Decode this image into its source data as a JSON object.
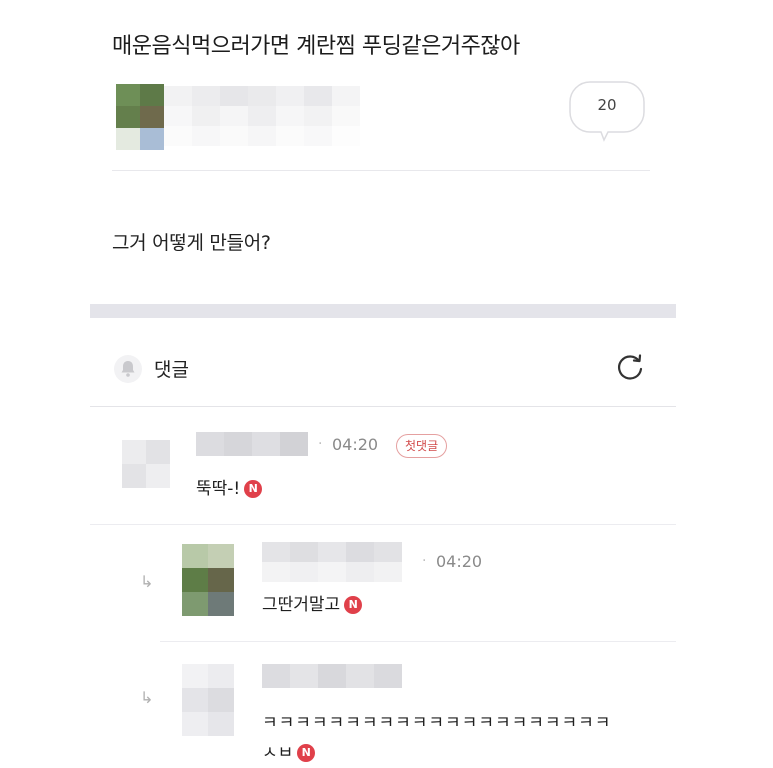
{
  "post": {
    "title": "매운음식먹으러가면 계란찜 푸딩같은거주잖아",
    "comment_count": "20",
    "body": "그거 어떻게 만들어?"
  },
  "comments_section": {
    "label": "댓글",
    "icons": {
      "bell": "bell-icon",
      "refresh": "refresh-icon"
    }
  },
  "comments": [
    {
      "time": "04:20",
      "badge": "첫댓글",
      "text": "뚝딱-!",
      "new_badge": "N"
    },
    {
      "time": "04:20",
      "text": "그딴거말고",
      "new_badge": "N",
      "is_reply": true
    },
    {
      "text_line1": "ㅋㅋㅋㅋㅋㅋㅋㅋㅋㅋㅋㅋㅋㅋㅋㅋㅋㅋㅋㅋㅋ",
      "text_line2": "ㅅㅂ",
      "new_badge": "N",
      "is_reply": true
    }
  ],
  "colors": {
    "accent_red": "#e0404a",
    "divider": "#e4e4ea"
  }
}
